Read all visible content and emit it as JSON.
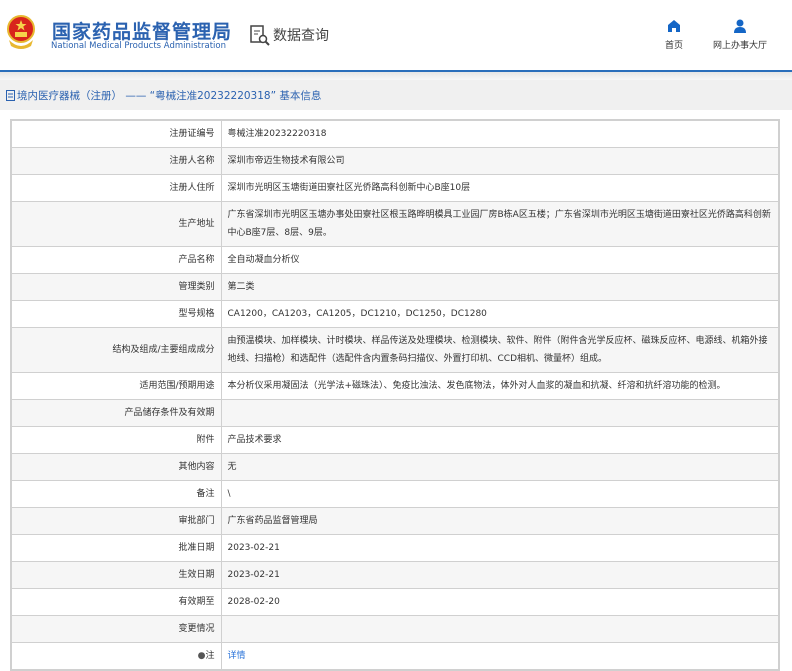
{
  "header": {
    "title_cn": "国家药品监督管理局",
    "title_en": "National Medical Products Administration",
    "data_query": "数据查询",
    "nav": [
      {
        "label": "首页",
        "icon": "home-icon"
      },
      {
        "label": "网上办事大厅",
        "icon": "user-icon"
      }
    ]
  },
  "page_title": "境内医疗器械（注册） —— “粤械注准20232220318” 基本信息",
  "rows": [
    {
      "label": "注册证编号",
      "value": "粤械注准20232220318"
    },
    {
      "label": "注册人名称",
      "value": "深圳市帝迈生物技术有限公司"
    },
    {
      "label": "注册人住所",
      "value": "深圳市光明区玉塘街道田寮社区光侨路高科创新中心B座10层"
    },
    {
      "label": "生产地址",
      "value": "广东省深圳市光明区玉塘办事处田寮社区根玉路晔明模具工业园厂房B栋A区五楼；广东省深圳市光明区玉塘街道田寮社区光侨路高科创新中心B座7层、8层、9层。"
    },
    {
      "label": "产品名称",
      "value": "全自动凝血分析仪"
    },
    {
      "label": "管理类别",
      "value": "第二类"
    },
    {
      "label": "型号规格",
      "value": "CA1200，CA1203，CA1205，DC1210，DC1250，DC1280"
    },
    {
      "label": "结构及组成/主要组成成分",
      "value": "由预温模块、加样模块、计时模块、样品传送及处理模块、检测模块、软件、附件（附件含光学反应杯、磁珠反应杯、电源线、机箱外接地线、扫描枪）和选配件（选配件含内置条码扫描仪、外置打印机、CCD相机、微量杯）组成。"
    },
    {
      "label": "适用范围/预期用途",
      "value": "本分析仪采用凝固法（光学法+磁珠法）、免疫比浊法、发色底物法，体外对人血浆的凝血和抗凝、纤溶和抗纤溶功能的检测。"
    },
    {
      "label": "产品储存条件及有效期",
      "value": ""
    },
    {
      "label": "附件",
      "value": "产品技术要求"
    },
    {
      "label": "其他内容",
      "value": "无"
    },
    {
      "label": "备注",
      "value": "\\"
    },
    {
      "label": "审批部门",
      "value": "广东省药品监督管理局"
    },
    {
      "label": "批准日期",
      "value": "2023-02-21"
    },
    {
      "label": "生效日期",
      "value": "2023-02-21"
    },
    {
      "label": "有效期至",
      "value": "2028-02-20"
    },
    {
      "label": "变更情况",
      "value": ""
    }
  ],
  "note": {
    "label": "注",
    "link": "详情"
  }
}
